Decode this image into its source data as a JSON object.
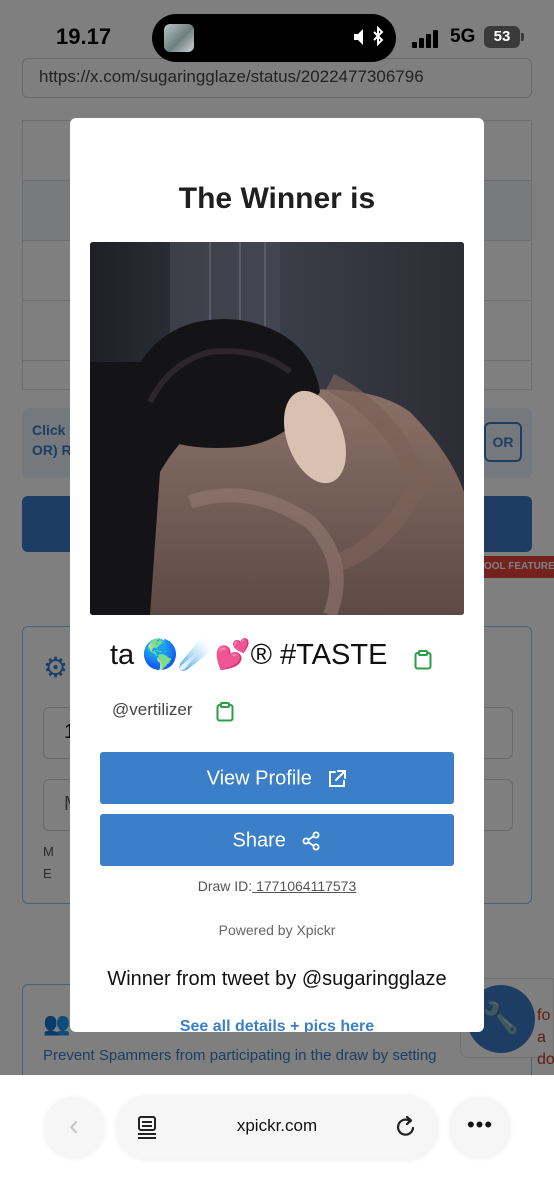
{
  "status_bar": {
    "time": "19.17",
    "network": "5G",
    "battery": "53"
  },
  "background": {
    "url_field_text": "https://x.com/sugaringglaze/status/2022477306796",
    "hint_text": "Click OR) R",
    "or_button": "OR",
    "badge_text": "OOL FEATURE",
    "input_1_value": "1",
    "input_2_value": "M",
    "card_text_1": "M",
    "card_text_2": "E",
    "spam_text": "Prevent Spammers from participating in the draw by setting",
    "side_widget_text_1": "fo",
    "side_widget_text_2": "a do"
  },
  "modal": {
    "title": "The Winner is",
    "winner_name": "ta 🌎☄️💕® #TASTE",
    "winner_handle": "@vertilizer",
    "view_profile_label": "View Profile",
    "share_label": "Share",
    "draw_id_label": "Draw ID:",
    "draw_id_value": " 1771064117573",
    "powered_by": "Powered by Xpickr",
    "winner_from": "Winner from tweet by @sugaringglaze",
    "see_details": "See all details + pics here"
  },
  "browser": {
    "domain": "xpickr.com"
  },
  "colors": {
    "primary": "#3a7fc7",
    "clipboard_green": "#2e9e49",
    "badge_red": "#e8453c"
  },
  "icons": [
    "signal-icon",
    "battery-icon",
    "gear-icon",
    "clipboard-icon",
    "external-link-icon",
    "share-icon",
    "page-icon",
    "reload-icon",
    "more-icon",
    "back-icon"
  ]
}
